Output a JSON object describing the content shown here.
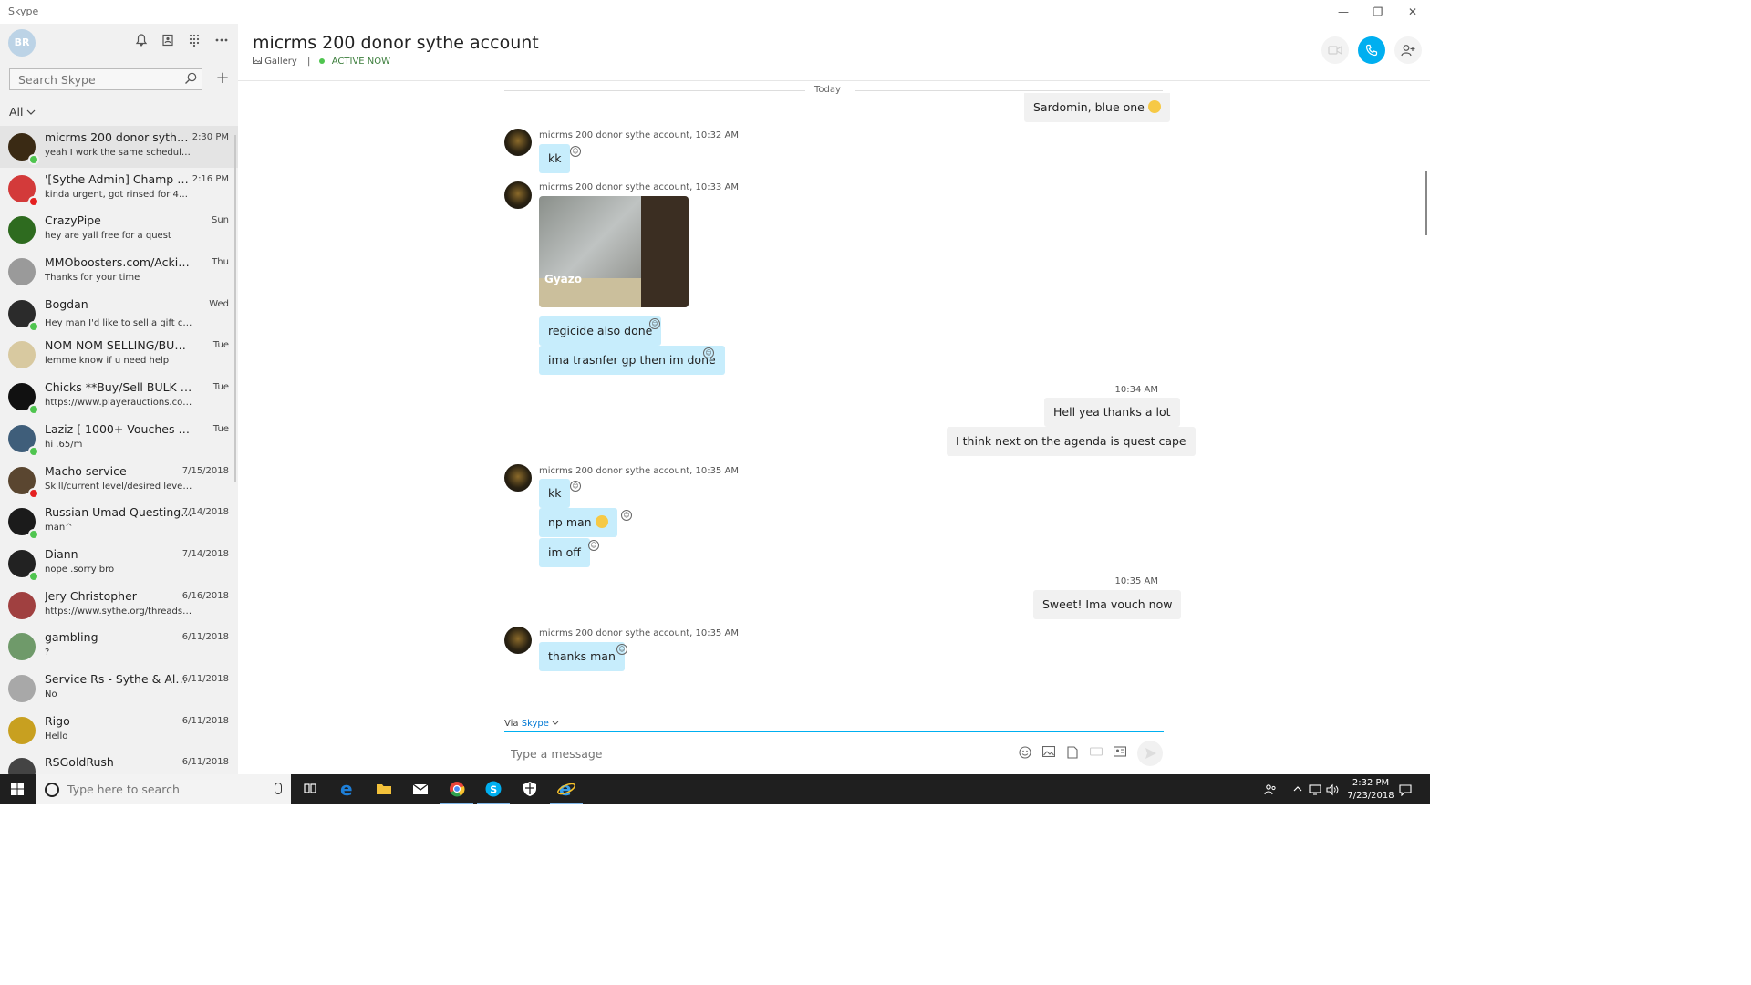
{
  "window": {
    "app_title": "Skype",
    "minimize": "—",
    "restore": "❐",
    "close": "✕"
  },
  "sidebar": {
    "avatar_initials": "BR",
    "search_placeholder": "Search Skype",
    "filter_label": "All",
    "contacts": [
      {
        "name": "micrms 200 donor sythe acc...",
        "preview": "yeah I work the same schedule just...",
        "time": "2:30 PM",
        "status": "#4fc54f",
        "avatar": "#3a2a14"
      },
      {
        "name": "'[Sythe Admin] Champ RSPS...",
        "preview": "kinda urgent, got rinsed for 410m b...",
        "time": "2:16 PM",
        "status": "#e52020",
        "avatar": "#d33a3a"
      },
      {
        "name": "CrazyPipe",
        "preview": "hey are yall free for a quest",
        "time": "Sun",
        "status": "",
        "avatar": "#2e6b1f"
      },
      {
        "name": "MMOboosters.com/Ackings -",
        "preview": "Thanks for your time",
        "time": "Thu",
        "status": "",
        "avatar": "#9a9a9a"
      },
      {
        "name": "Bogdan",
        "preview": "Hey man I'd like to sell a gift card",
        "time": "Wed",
        "status": "#4fc54f",
        "avatar": "#2b2b2b",
        "emoji": true
      },
      {
        "name": "NOM NOM SELLING/BUYING...",
        "preview": "lemme know if u need help",
        "time": "Tue",
        "status": "",
        "avatar": "#d8c9a0"
      },
      {
        "name": "Chicks **Buy/Sell BULK 07/RS3...",
        "preview": "https://www.playerauctions.com/rs2007...",
        "time": "Tue",
        "status": "#4fc54f",
        "avatar": "#111111"
      },
      {
        "name": "Laziz [ 1000+ Vouches ] Buy &...",
        "preview": "hi .65/m",
        "time": "Tue",
        "status": "#4fc54f",
        "avatar": "#3f5e7a"
      },
      {
        "name": "Macho service",
        "preview": "Skill/current level/desired level/xp...",
        "time": "7/15/2018",
        "status": "#e52020",
        "avatar": "#5a4630"
      },
      {
        "name": "Russian Umad Questing |...",
        "preview": "man^",
        "time": "7/14/2018",
        "status": "#4fc54f",
        "avatar": "#1b1b1b"
      },
      {
        "name": "Diann",
        "preview": "nope .sorry bro",
        "time": "7/14/2018",
        "status": "#4fc54f",
        "avatar": "#222222"
      },
      {
        "name": "Jery Christopher",
        "preview": "https://www.sythe.org/threads/un...",
        "time": "6/16/2018",
        "status": "",
        "avatar": "#a04040"
      },
      {
        "name": "gambling",
        "preview": "?",
        "time": "6/11/2018",
        "status": "",
        "avatar": "#6f9a6a"
      },
      {
        "name": "Service Rs - Sythe & Alwa...",
        "preview": "No",
        "time": "6/11/2018",
        "status": "",
        "avatar": "#a8a8a8"
      },
      {
        "name": "Rigo",
        "preview": "Hello",
        "time": "6/11/2018",
        "status": "",
        "avatar": "#c8a020"
      },
      {
        "name": "RSGoldRush",
        "preview": "",
        "time": "6/11/2018",
        "status": "",
        "avatar": "#444444"
      }
    ]
  },
  "chat": {
    "title": "micrms 200 donor sythe account",
    "gallery_label": "Gallery",
    "separator": "|",
    "status_text": "ACTIVE NOW",
    "day_label": "Today",
    "messages": {
      "out0": "Sardomin, blue one",
      "meta1": "micrms 200 donor sythe account,  10:32 AM",
      "in1": "kk",
      "meta2": "micrms 200 donor sythe account,  10:33 AM",
      "gyazo": "Gyazo",
      "in2": "regicide also done",
      "in3": "ima trasnfer gp then im done",
      "time_out1": "10:34 AM",
      "out1": "Hell yea thanks a lot",
      "out2": "I think next on the agenda is quest cape",
      "meta3": "micrms 200 donor sythe account,  10:35 AM",
      "in4": "kk",
      "in5": "np man",
      "in6": "im off",
      "time_out2": "10:35 AM",
      "out3": "Sweet! Ima vouch now",
      "meta4": "micrms 200 donor sythe account,  10:35 AM",
      "in7": "thanks man"
    }
  },
  "composer": {
    "via_label": "Via",
    "via_service": "Skype",
    "placeholder": "Type a message"
  },
  "taskbar": {
    "search_placeholder": "Type here to search",
    "time": "2:32 PM",
    "date": "7/23/2018"
  },
  "colors": {
    "accent": "#00aff0",
    "incoming_bubble": "#c7edfc",
    "outgoing_bubble": "#f1f1f1",
    "online": "#4fc54f",
    "busy": "#e52020"
  }
}
